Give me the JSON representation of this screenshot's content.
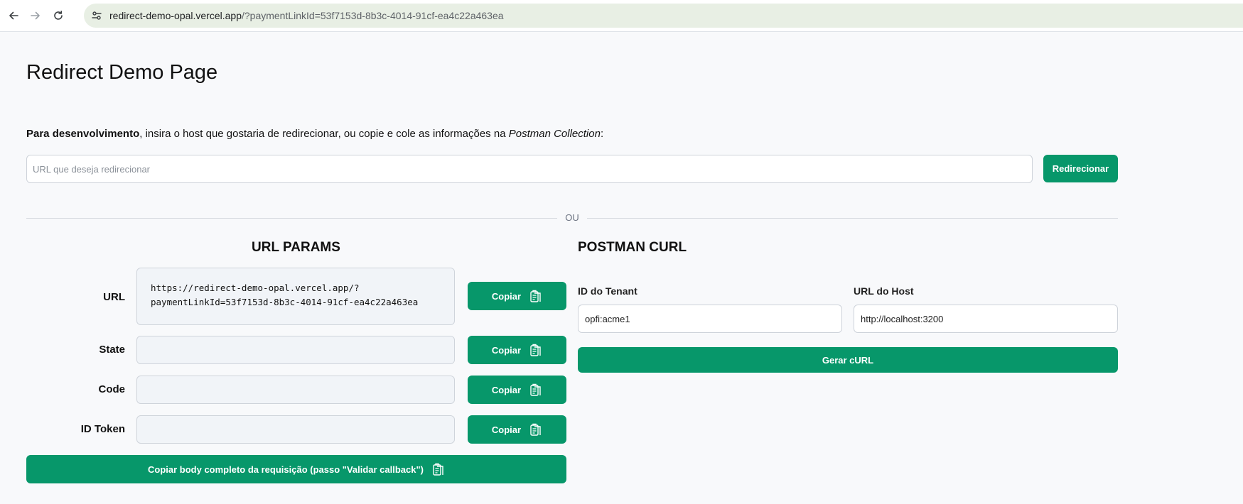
{
  "browser": {
    "address_host": "redirect-demo-opal.vercel.app",
    "address_rest": "/?paymentLinkId=53f7153d-8b3c-4014-91cf-ea4c22a463ea"
  },
  "page": {
    "title": "Redirect Demo Page",
    "intro_bold": "Para desenvolvimento",
    "intro_text": ", insira o host que gostaria de redirecionar, ou copie e cole as informações na ",
    "intro_italic": "Postman Collection",
    "intro_end": ":",
    "url_placeholder": "URL que deseja redirecionar",
    "redirect_label": "Redirecionar",
    "divider_label": "OU"
  },
  "url_params": {
    "heading": "URL PARAMS",
    "copy_label": "Copiar",
    "rows": [
      {
        "label": "URL",
        "value": "https://redirect-demo-opal.vercel.app/?\npaymentLinkId=53f7153d-8b3c-4014-91cf-ea4c22a463ea"
      },
      {
        "label": "State",
        "value": ""
      },
      {
        "label": "Code",
        "value": ""
      },
      {
        "label": "ID Token",
        "value": ""
      }
    ],
    "full_copy_label": "Copiar body completo da requisição (passo \"Validar callback\")"
  },
  "postman": {
    "heading": "POSTMAN CURL",
    "tenant_label": "ID do Tenant",
    "tenant_value": "opfi:acme1",
    "host_label": "URL do Host",
    "host_value": "http://localhost:3200",
    "generate_label": "Gerar cURL"
  },
  "colors": {
    "accent": "#07976a"
  }
}
